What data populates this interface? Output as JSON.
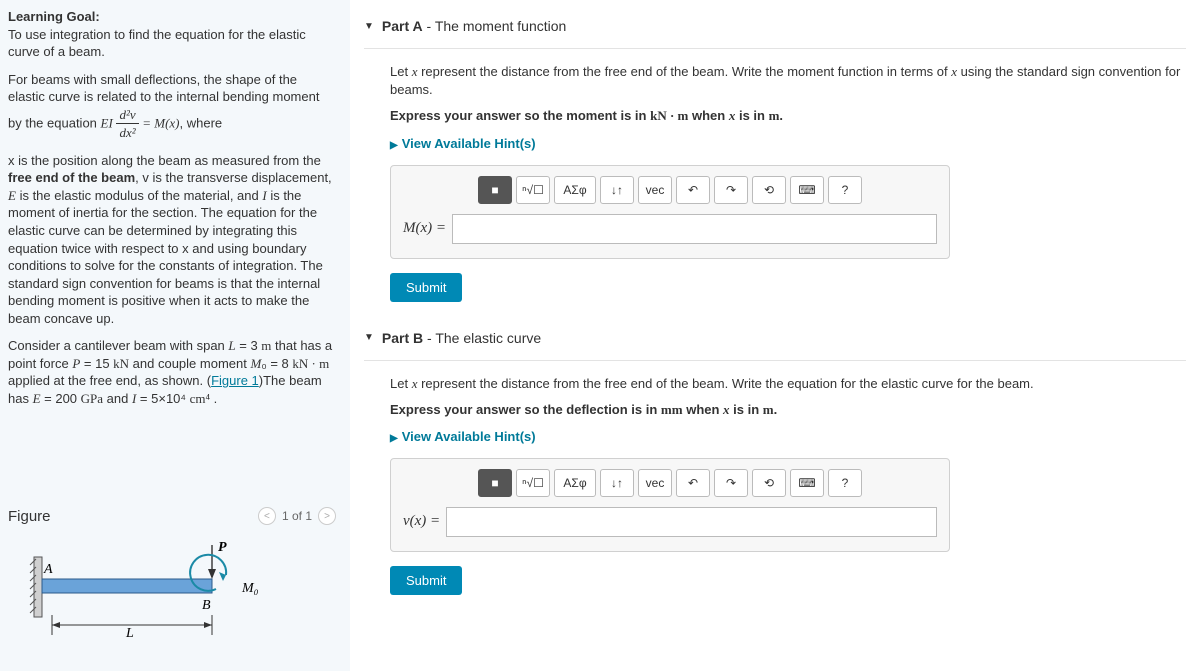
{
  "left": {
    "learningGoalLabel": "Learning Goal:",
    "learningGoalText": "To use integration to find the equation for the elastic curve of a beam.",
    "theory1a": "For beams with small deflections, the shape of the elastic curve is related to the internal bending moment by the equation ",
    "theory1b": ", where",
    "eq_EI": "EI",
    "eq_num": "d²v",
    "eq_den": "dx²",
    "eq_rhs": " = M(x)",
    "theory2": "x is the position along the beam as measured from the free end of the beam, v is the transverse displacement, E is the elastic modulus of the material, and I is the moment of inertia for the section. The equation for the elastic curve can be determined by integrating this equation twice with respect to x and using boundary conditions to solve for the constants of integration. The standard sign convention for beams is that the internal bending moment is positive when it acts to make the beam concave up.",
    "theory3a": "Consider a cantilever beam with span L = 3 m that has a point force P = 15 kN and couple moment M₀ = 8 kN · m applied at the free end, as shown. (",
    "figureLink": "Figure 1",
    "theory3b": ")The beam has E = 200 GPa and I = 5×10⁴ cm⁴ .",
    "figureTitle": "Figure",
    "pager": "1 of 1",
    "beam": {
      "A": "A",
      "B": "B",
      "P": "P",
      "M0": "M₀",
      "L": "L"
    }
  },
  "partA": {
    "titleBold": "Part A",
    "titleRest": " - The moment function",
    "q1": "Let x represent the distance from the free end of the beam. Write the moment function in terms of x using the standard sign convention for beams.",
    "express": "Express your answer so the moment is in kN · m when x is in m.",
    "hints": "View Available Hint(s)",
    "ansLabel": "M(x) =",
    "submit": "Submit"
  },
  "partB": {
    "titleBold": "Part B",
    "titleRest": " - The elastic curve",
    "q1": "Let x represent the distance from the free end of the beam. Write the equation for the elastic curve for the beam.",
    "express": "Express your answer so the deflection is in mm when x is in m.",
    "hints": "View Available Hint(s)",
    "ansLabel": "v(x) =",
    "submit": "Submit"
  },
  "toolbar": {
    "templates": "■",
    "sqrt": "ⁿ√☐",
    "greek": "ΑΣφ",
    "subsup": "↓↑",
    "vec": "vec",
    "undo": "↶",
    "redo": "↷",
    "reset": "⟲",
    "keyboard": "⌨",
    "help": "?"
  }
}
